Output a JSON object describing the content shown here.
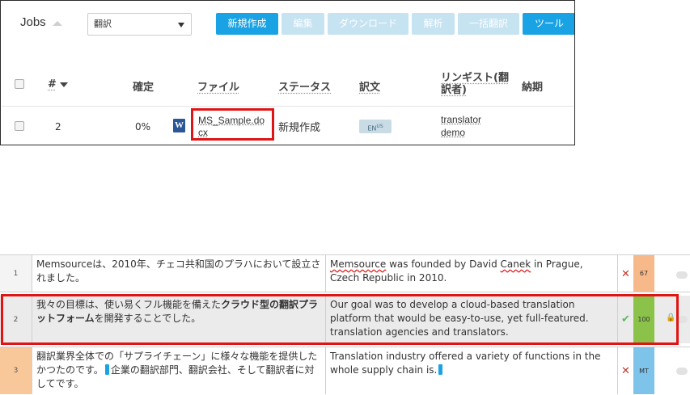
{
  "jobs": {
    "title": "Jobs",
    "select_value": "翻訳",
    "toolbar": [
      {
        "label": "新規作成",
        "enabled": true
      },
      {
        "label": "編集",
        "enabled": false
      },
      {
        "label": "ダウンロード",
        "enabled": false
      },
      {
        "label": "解析",
        "enabled": false
      },
      {
        "label": "一括翻訳",
        "enabled": false
      },
      {
        "label": "ツール",
        "enabled": true
      }
    ],
    "columns": {
      "num": "#",
      "confirmed": "確定",
      "file": "ファイル",
      "status": "ステータス",
      "translation": "訳文",
      "linguist": "リンギスト(翻訳者)",
      "due": "納期"
    },
    "row": {
      "num": "2",
      "confirmed": "0%",
      "file": "MS_Sample.docx",
      "status": "新規作成",
      "lang": "EN",
      "lang_region": "US",
      "linguist_first": "translator",
      "linguist_last": "demo"
    }
  },
  "editor": {
    "segments": [
      {
        "num": "1",
        "source": "Memsourceは、2010年、チェコ共和国のプラハにおいて設立されました。",
        "target_a": "Memsource",
        "target_b": " was founded by David ",
        "target_c": "Canek",
        "target_d": " in Prague, Czech Republic in 2010.",
        "state": "✕",
        "score": "67"
      },
      {
        "num": "2",
        "source_a": "我々の目標は、使い易くフル機能を備えた",
        "source_b": "クラウド型の翻訳プラットフォーム",
        "source_c": "を開発することでした。",
        "target": "Our goal was to develop a cloud-based translation platform that would be easy-to-use, yet full-featured.  translation agencies and translators.",
        "state": "✔",
        "score": "100"
      },
      {
        "num": "3",
        "source_a": "翻訳業界全体での「サプライチェーン」に様々な機能を提供したかつたのです。",
        "source_b": "企業の翻訳部門、翻訳会社、そして翻訳者に対してです。",
        "target": "Translation industry offered a variety of functions in the whole supply chain is.",
        "state": "✕",
        "score": "MT"
      }
    ]
  }
}
